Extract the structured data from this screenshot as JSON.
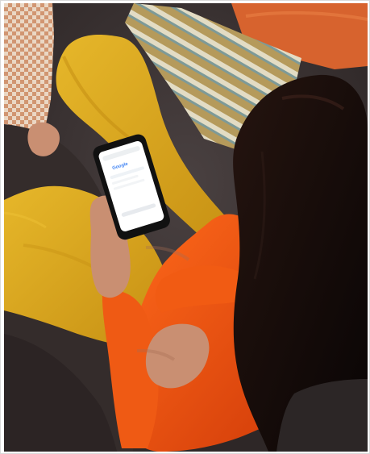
{
  "image": {
    "kind": "photograph",
    "palette": {
      "sofa": "#3b3433",
      "sofa_shadow": "#261f1f",
      "pants": "#d7a519",
      "pants_shadow": "#b98711",
      "shirt": "#e84f12",
      "shirt_shadow": "#b73008",
      "hair": "#150d0b",
      "skin": "#c98f72",
      "pillow_orange": "#d7632e",
      "pillow_stripes": "#c8b98e",
      "phone": "#111111",
      "phone_screen": "#ffffff"
    },
    "icons": [
      "woman-using-phone",
      "smartphone-icon",
      "search-engine-logo-icon"
    ],
    "phone_screen": {
      "logo_text": "Google"
    }
  }
}
